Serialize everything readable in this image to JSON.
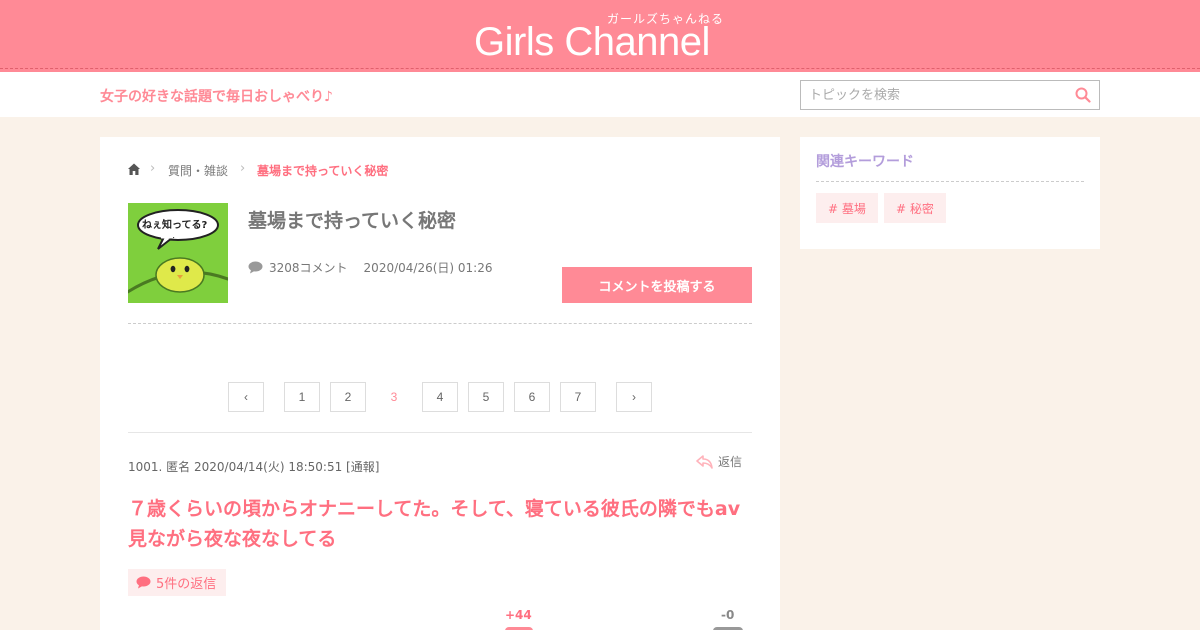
{
  "header": {
    "logo_kana": "ガールズちゃんねる",
    "logo_text": "Girls Channel",
    "tagline": "女子の好きな話題で毎日おしゃべり♪",
    "search_placeholder": "トピックを検索"
  },
  "breadcrumb": {
    "items": [
      "質問・雑談",
      "墓場まで持っていく秘密"
    ]
  },
  "topic": {
    "thumbnail_text": "ねぇ知ってる?",
    "title": "墓場まで持っていく秘密",
    "comment_count": "3208コメント",
    "date": "2020/04/26(日) 01:26",
    "post_button": "コメントを投稿する"
  },
  "pagination": {
    "prev": "‹",
    "pages": [
      "1",
      "2",
      "3",
      "4",
      "5",
      "6",
      "7"
    ],
    "current": "3",
    "next": "›"
  },
  "comment": {
    "meta": "1001. 匿名 2020/04/14(火) 18:50:51 [通報]",
    "reply_label": "返信",
    "body": "７歳くらいの頃からオナニーしてた。そして、寝ている彼氏の隣でもav見ながら夜な夜なしてる",
    "replies_label": "5件の返信",
    "plus": "+44",
    "minus": "-0"
  },
  "sidebar": {
    "title": "関連キーワード",
    "keywords": [
      "# 墓場",
      "# 秘密"
    ]
  },
  "colors": {
    "brand": "#ff8a96",
    "accent_text": "#ff6f80",
    "background": "#faf2e9",
    "sidebar_title": "#b39ddb"
  }
}
